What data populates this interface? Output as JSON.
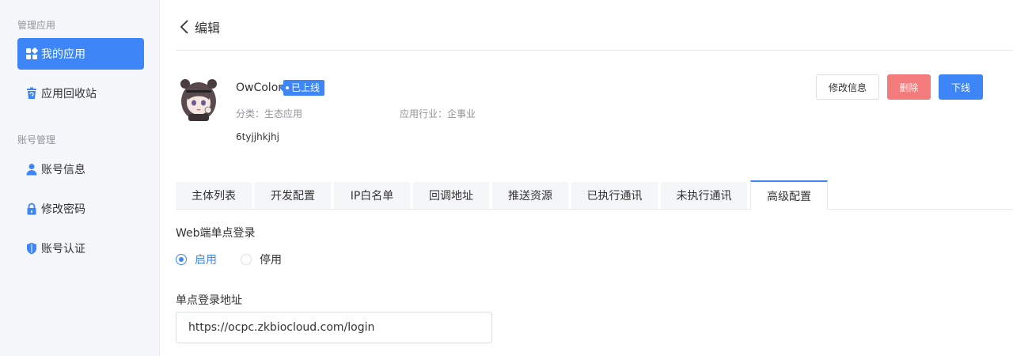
{
  "sidebar": {
    "groups": [
      "管理应用",
      "账号管理"
    ],
    "items": [
      {
        "label": "我的应用",
        "icon": "grid-icon"
      },
      {
        "label": "应用回收站",
        "icon": "recycle-bin-icon"
      },
      {
        "label": "账号信息",
        "icon": "user-icon"
      },
      {
        "label": "修改密码",
        "icon": "lock-icon"
      },
      {
        "label": "账号认证",
        "icon": "shield-icon"
      }
    ]
  },
  "header": {
    "back_label": "编辑"
  },
  "app": {
    "name": "OwColor",
    "status": "已上线",
    "category": "分类：生态应用",
    "industry": "应用行业：企事业",
    "id": "6tyjjhkjhj"
  },
  "actions": {
    "edit": "修改信息",
    "delete": "删除",
    "offline": "下线"
  },
  "tabs": [
    "主体列表",
    "开发配置",
    "IP白名单",
    "回调地址",
    "推送资源",
    "已执行通讯",
    "未执行通讯",
    "高级配置"
  ],
  "sso": {
    "label": "Web端单点登录",
    "options": [
      "启用",
      "停用"
    ],
    "selected": "启用",
    "url_label": "单点登录地址",
    "url_value": "https://ocpc.zkbiocloud.com/login"
  },
  "colors": {
    "accent": "#3e86f7",
    "danger": "#f47b7b"
  }
}
